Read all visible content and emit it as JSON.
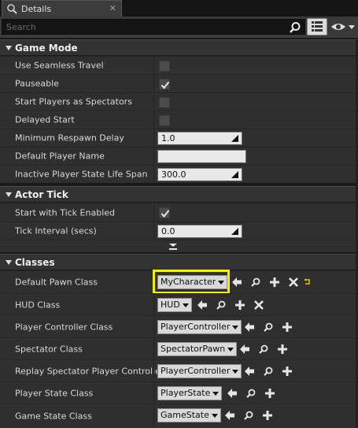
{
  "tab": {
    "title": "Details",
    "close": "✕"
  },
  "search": {
    "placeholder": "Search"
  },
  "categories": {
    "game_mode": "Game Mode",
    "actor_tick": "Actor Tick",
    "classes": "Classes"
  },
  "game_mode": {
    "use_seamless_travel": {
      "label": "Use Seamless Travel",
      "checked": false
    },
    "pauseable": {
      "label": "Pauseable",
      "checked": true
    },
    "start_players_as_spectators": {
      "label": "Start Players as Spectators",
      "checked": false
    },
    "delayed_start": {
      "label": "Delayed Start",
      "checked": false
    },
    "minimum_respawn_delay": {
      "label": "Minimum Respawn Delay",
      "value": "1.0"
    },
    "default_player_name": {
      "label": "Default Player Name",
      "value": ""
    },
    "inactive_player_state_life_span": {
      "label": "Inactive Player State Life Span",
      "value": "300.0"
    }
  },
  "actor_tick": {
    "start_with_tick_enabled": {
      "label": "Start with Tick Enabled",
      "checked": true
    },
    "tick_interval": {
      "label": "Tick Interval (secs)",
      "value": "0.0"
    }
  },
  "classes": {
    "default_pawn_class": {
      "label": "Default Pawn Class",
      "value": "MyCharacter"
    },
    "hud_class": {
      "label": "HUD Class",
      "value": "HUD"
    },
    "player_controller_class": {
      "label": "Player Controller Class",
      "value": "PlayerController"
    },
    "spectator_class": {
      "label": "Spectator Class",
      "value": "SpectatorPawn"
    },
    "replay_spectator_player_controller": {
      "label": "Replay Spectator Player Controller",
      "value": "PlayerController"
    },
    "player_state_class": {
      "label": "Player State Class",
      "value": "PlayerState"
    },
    "game_state_class": {
      "label": "Game State Class",
      "value": "GameState"
    }
  },
  "colors": {
    "highlight": "#f2f000",
    "reset_arrow": "#f0c000"
  },
  "icons": [
    "details-tab-icon",
    "search-icon",
    "property-matrix-icon",
    "visibility-eye-icon",
    "use-selected-arrow-icon",
    "browse-magnifier-icon",
    "new-blueprint-plus-icon",
    "clear-x-icon",
    "reset-to-default-icon",
    "advanced-expand-icon"
  ]
}
